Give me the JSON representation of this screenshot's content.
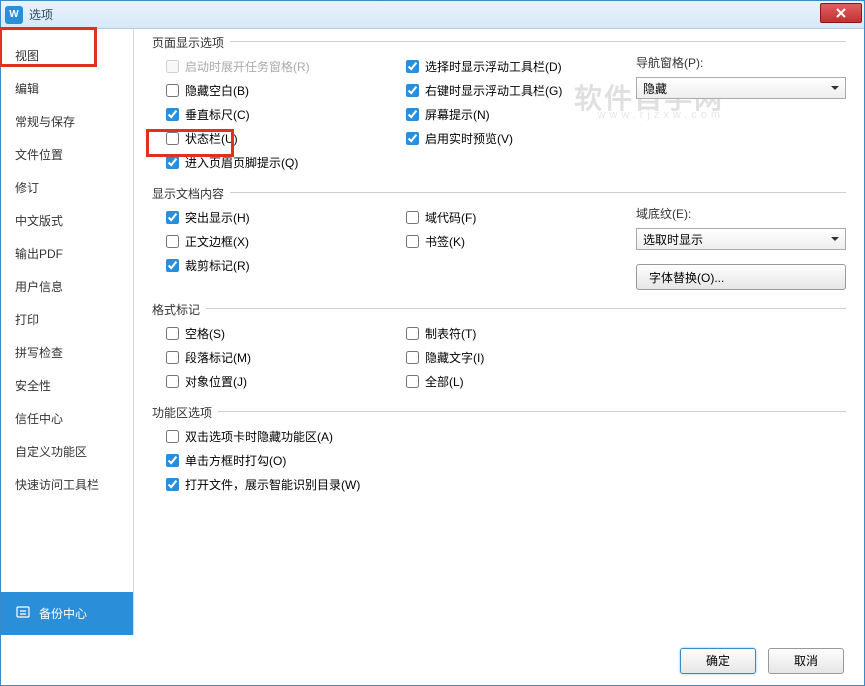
{
  "window": {
    "title": "选项"
  },
  "sidebar": {
    "items": [
      "视图",
      "编辑",
      "常规与保存",
      "文件位置",
      "修订",
      "中文版式",
      "输出PDF",
      "用户信息",
      "打印",
      "拼写检查",
      "安全性",
      "信任中心",
      "自定义功能区",
      "快速访问工具栏"
    ],
    "backup": "备份中心"
  },
  "groups": {
    "page_display": {
      "title": "页面显示选项",
      "col1": [
        {
          "label": "启动时展开任务窗格(R)",
          "checked": false,
          "disabled": true
        },
        {
          "label": "隐藏空白(B)",
          "checked": false
        },
        {
          "label": "垂直标尺(C)",
          "checked": true
        },
        {
          "label": "状态栏(U)",
          "checked": false
        },
        {
          "label": "进入页眉页脚提示(Q)",
          "checked": true
        }
      ],
      "col2": [
        {
          "label": "选择时显示浮动工具栏(D)",
          "checked": true
        },
        {
          "label": "右键时显示浮动工具栏(G)",
          "checked": true
        },
        {
          "label": "屏幕提示(N)",
          "checked": true
        },
        {
          "label": "启用实时预览(V)",
          "checked": true
        }
      ],
      "nav_label": "导航窗格(P):",
      "nav_value": "隐藏"
    },
    "doc_content": {
      "title": "显示文档内容",
      "col1": [
        {
          "label": "突出显示(H)",
          "checked": true
        },
        {
          "label": "正文边框(X)",
          "checked": false
        },
        {
          "label": "裁剪标记(R)",
          "checked": true
        }
      ],
      "col2": [
        {
          "label": "域代码(F)",
          "checked": false
        },
        {
          "label": "书签(K)",
          "checked": false
        }
      ],
      "shade_label": "域底纹(E):",
      "shade_value": "选取时显示",
      "font_sub_btn": "字体替换(O)..."
    },
    "format_marks": {
      "title": "格式标记",
      "col1": [
        {
          "label": "空格(S)",
          "checked": false
        },
        {
          "label": "段落标记(M)",
          "checked": false
        },
        {
          "label": "对象位置(J)",
          "checked": false
        }
      ],
      "col2": [
        {
          "label": "制表符(T)",
          "checked": false
        },
        {
          "label": "隐藏文字(I)",
          "checked": false
        },
        {
          "label": "全部(L)",
          "checked": false
        }
      ]
    },
    "ribbon": {
      "title": "功能区选项",
      "items": [
        {
          "label": "双击选项卡时隐藏功能区(A)",
          "checked": false
        },
        {
          "label": "单击方框时打勾(O)",
          "checked": true
        },
        {
          "label": "打开文件，展示智能识别目录(W)",
          "checked": true
        }
      ]
    }
  },
  "footer": {
    "ok": "确定",
    "cancel": "取消"
  },
  "watermark": {
    "main": "软件自学网",
    "sub": "www.rjzxw.com"
  }
}
